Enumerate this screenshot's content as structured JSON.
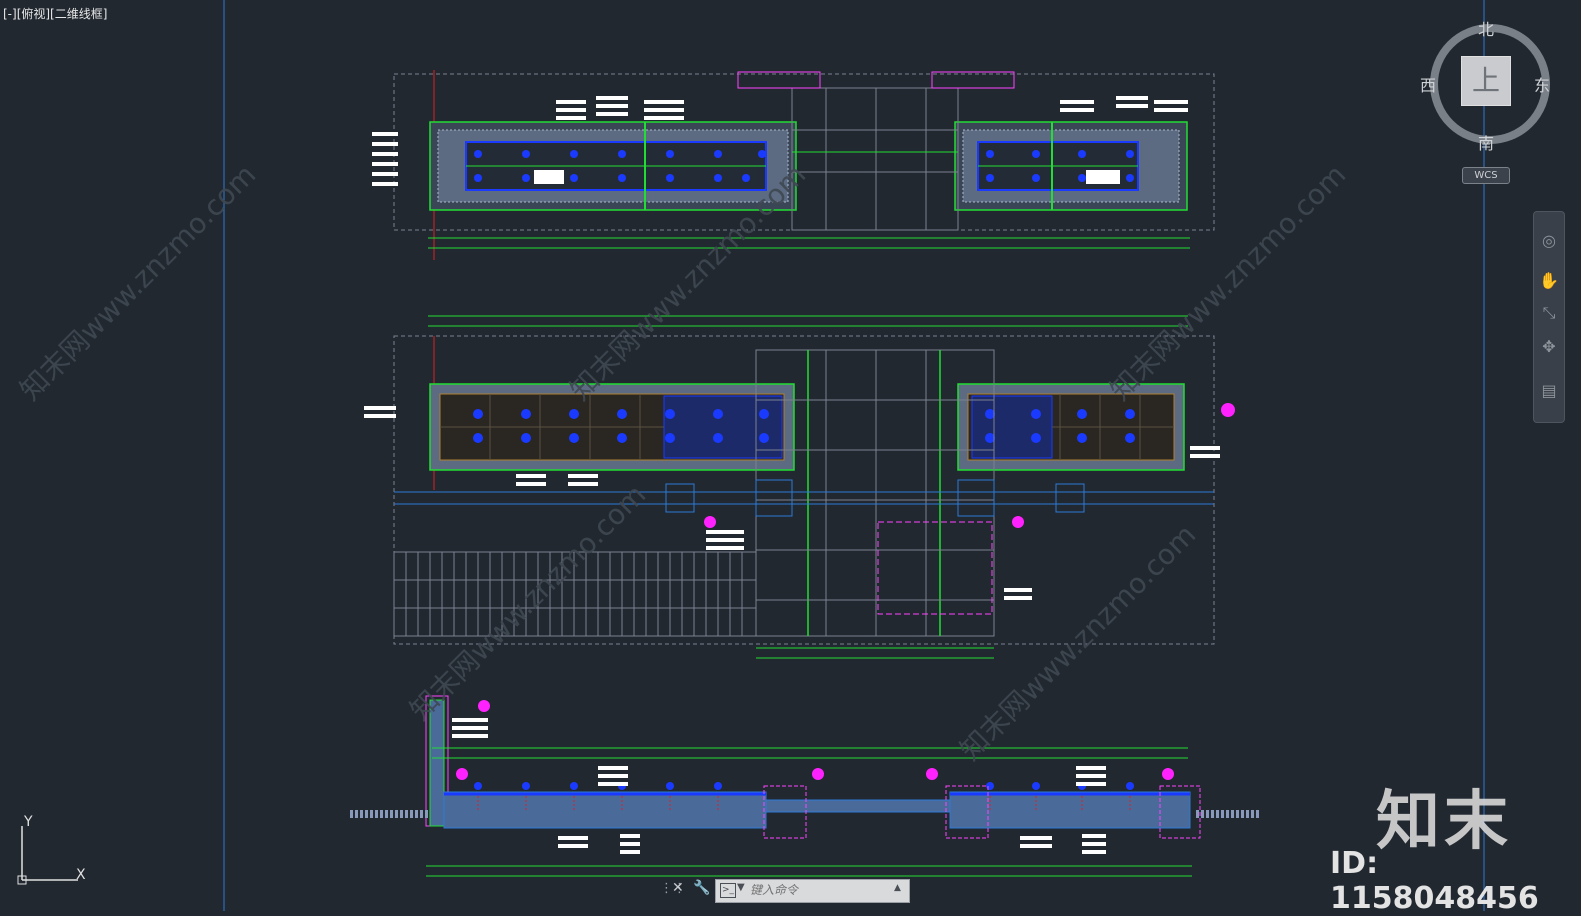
{
  "viewport": {
    "label": "[-][俯视][二维线框]"
  },
  "viewcube": {
    "top_face": "上",
    "north": "北",
    "south": "南",
    "west": "西",
    "east": "东",
    "coordinate_system": "WCS"
  },
  "navigation_bar": {
    "items": [
      "steering-wheel-icon",
      "pan-hand-icon",
      "zoom-icon",
      "orbit-icon",
      "showmotion-icon"
    ]
  },
  "command_line": {
    "placeholder": "键入命令"
  },
  "ucs_icon": {
    "x_label": "X",
    "y_label": "Y"
  },
  "watermark": {
    "logo": "知末",
    "id": "ID: 1158048456",
    "diagonal_text": "知末网www.znzmo.com"
  },
  "colors": {
    "background": "#212830",
    "green_lines": "#22dd33",
    "blue_fixtures": "#1a3bff",
    "magenta_markers": "#ff22ff",
    "red_axis": "#dd2222",
    "hatch": "#8899bb"
  }
}
